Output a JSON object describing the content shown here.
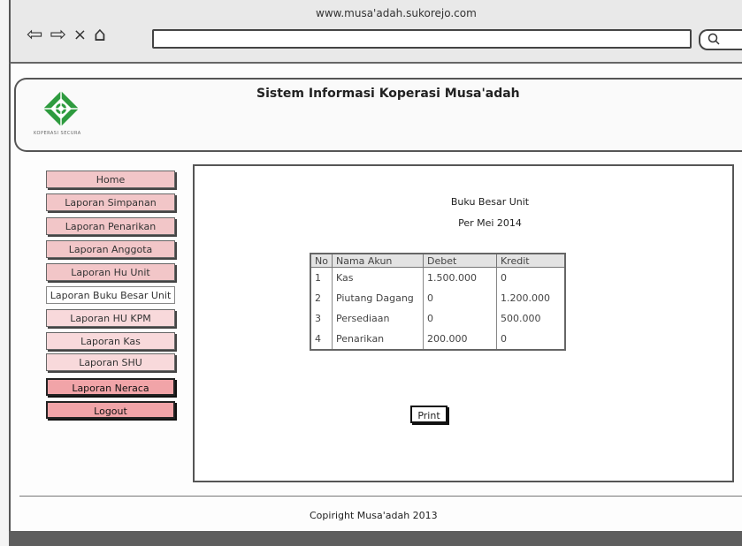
{
  "browser": {
    "url": "www.musa'adah.sukorejo.com",
    "icons": [
      "back-arrow-icon",
      "forward-arrow-icon",
      "close-icon",
      "home-icon",
      "search-icon"
    ],
    "back_glyph": "⇦",
    "forward_glyph": "⇨",
    "close_glyph": "×",
    "home_glyph": "⌂"
  },
  "header": {
    "title": "Sistem Informasi Koperasi Musa'adah",
    "logo_caption": "KOPERASI SECURA"
  },
  "sidebar": {
    "items": [
      {
        "label": "Home"
      },
      {
        "label": "Laporan Simpanan"
      },
      {
        "label": "Laporan Penarikan"
      },
      {
        "label": "Laporan Anggota"
      },
      {
        "label": "Laporan Hu Unit"
      },
      {
        "label": "Laporan Buku Besar Unit"
      },
      {
        "label": "Laporan HU KPM"
      },
      {
        "label": "Laporan Kas"
      },
      {
        "label": "Laporan SHU"
      },
      {
        "label": "Laporan Neraca"
      },
      {
        "label": "Logout"
      }
    ]
  },
  "report": {
    "title": "Buku Besar Unit",
    "period": "Per Mei 2014",
    "columns": [
      "No",
      "Nama Akun",
      "Debet",
      "Kredit"
    ],
    "rows": [
      [
        "1",
        "Kas",
        "1.500.000",
        "0"
      ],
      [
        "2",
        "Piutang Dagang",
        "0",
        "1.200.000"
      ],
      [
        "3",
        "Persediaan",
        "0",
        "500.000"
      ],
      [
        "4",
        "Penarikan",
        "200.000",
        "0"
      ]
    ],
    "print_label": "Print"
  },
  "footer": {
    "text": "Copiright Musa'adah 2013"
  },
  "colors": {
    "menu_pink": "#f2c6c8",
    "menu_light": "#f8d9db",
    "menu_strong": "#f1a4a8",
    "logo_green": "#2e9b3f"
  }
}
